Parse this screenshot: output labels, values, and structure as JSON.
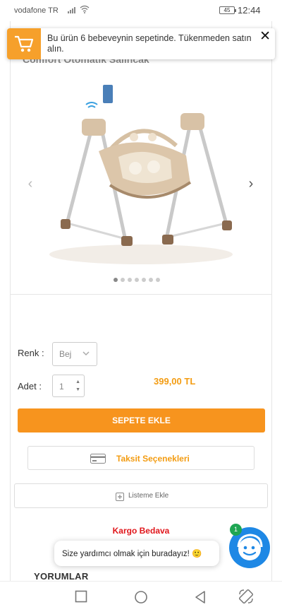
{
  "status_bar": {
    "carrier": "vodafone TR",
    "battery": "45",
    "time": "12:44"
  },
  "toast": {
    "message": "Bu ürün 6 bebeveynin sepetinde. Tükenmeden satın alın.",
    "close": "✕",
    "icon": "cart-icon"
  },
  "product": {
    "title": "Comfort Otomatik Salıncak",
    "price": "399,00 TL"
  },
  "gallery": {
    "dots_total": 7,
    "active_dot": 0,
    "prev": "‹",
    "next": "›"
  },
  "options": {
    "color_label": "Renk :",
    "color_value": "Bej",
    "quantity_label": "Adet :",
    "quantity_value": "1"
  },
  "buttons": {
    "add_to_cart": "SEPETE EKLE",
    "installments": "Taksit Seçenekleri",
    "add_to_list": "Listeme Ekle"
  },
  "shipping_note": "Kargo Bedava",
  "reviews_title": "YORUMLAR",
  "chat": {
    "message": "Size yardımcı olmak için buradayız! 🙂",
    "badge": "1"
  },
  "colors": {
    "accent": "#f7941e",
    "price": "#f39c12",
    "free_shipping": "#e0161b",
    "chat": "#1e88e5"
  }
}
